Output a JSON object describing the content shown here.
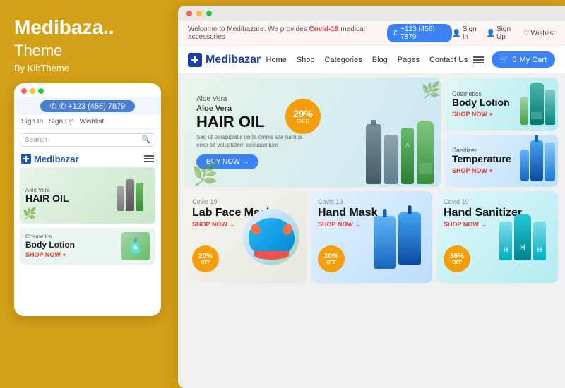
{
  "left": {
    "title": "Medibaza..",
    "subtitle": "Theme",
    "by": "By KlbTheme",
    "mobile": {
      "phone_number": "✆ +123 (456) 7879",
      "signin": "Sign In",
      "signup": "Sign Up",
      "wishlist": "Wishlist",
      "search_placeholder": "Search",
      "logo": "Medibazar",
      "hero": {
        "small": "Aloe Vera",
        "title": "Aloe Vera",
        "big": "HAIR OIL"
      },
      "card": {
        "label": "Cosmetics",
        "title": "Body Lotion",
        "shop_now": "SHOP NOW +"
      }
    }
  },
  "main": {
    "topbar": {
      "welcome": "Welcome to Medibazare. We provides",
      "covid_link": "Covid-19",
      "covid_suffix": "medical accessories",
      "phone": "+123 (456) 7879",
      "signin": "Sign In",
      "signup": "Sign Up",
      "wishlist": "Wishlist"
    },
    "navbar": {
      "logo": "Medibazar",
      "links": [
        "Home",
        "Shop",
        "Categories",
        "Blog",
        "Pages",
        "Contact Us"
      ],
      "cart": "My Cart",
      "cart_count": "0"
    },
    "hero": {
      "small": "Aloe Vera",
      "title": "Aloe Vera",
      "big": "HAIR OIL",
      "desc": "Sed ut perspiciatis unde omnis iste namus error sit voluptatem accusantium",
      "btn": "BUY NOW →",
      "badge_pct": "29%",
      "badge_off": "OFF"
    },
    "side_banners": [
      {
        "label": "Cosmetics",
        "title": "Body Lotion",
        "shop": "SHOP NOW +"
      },
      {
        "label": "Sanitizer",
        "title": "Temperature",
        "shop": "SHOP NOW +"
      }
    ],
    "product_cards": [
      {
        "label": "Covid 19",
        "title": "Lab Face Mask",
        "shop": "SHOP NOW →",
        "badge": "20%",
        "badge_off": "OFF"
      },
      {
        "label": "Covid 19",
        "title": "Hand Mask",
        "shop": "SHOP NOW →",
        "badge": "10%",
        "badge_off": "OFF"
      },
      {
        "label": "Covid 19",
        "title": "Hand Sanitizer",
        "shop": "SHOP NOW →",
        "badge": "30%",
        "badge_off": "OFF"
      }
    ]
  }
}
